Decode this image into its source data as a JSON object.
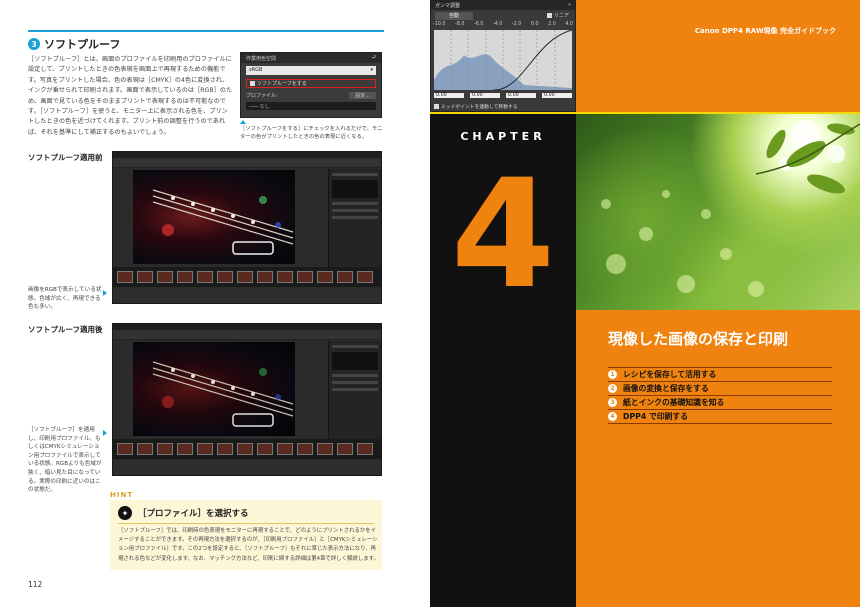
{
  "left_page": {
    "section": {
      "number": "3",
      "title": "ソフトプルーフ"
    },
    "body": "［ソフトプルーフ］とは、画面のプロファイルを印刷用のプロファイルに設定して、プリントしたときの色表現を画面上で再現するための機能です。写真をプリントした場合、色の表現は［CMYK］の4色に変換され、インクが乗せられて印刷されます。画面で表示しているのは［RGB］のため、画面で見ている色をそのままプリントで表現するのは不可能なのです。［ソフトプルーフ］を使うと、モニター上に表示される色を、プリントしたときの色を近づけてくれます。プリント前の調整を行うのであれば、それを基準にして補正するのもよいでしょう。",
    "dialog": {
      "title": "作業用色空間",
      "select_value": "sRGB",
      "checkbox_label": "ソフトプルーフをする",
      "profile_label": "プロファイル:",
      "settings_button": "設定...",
      "profile_value": "なし"
    },
    "dialog_caption": "［ソフトプルーフをする］にチェックを入れるだけで、モニターの色がプリントしたときの色の表現に近くなる。",
    "before_heading": "ソフトプルーフ適用前",
    "before_caption": "画像をRGBで表示している状態。色域が広く、再現できる色も多い。",
    "after_heading": "ソフトプルーフ適用後",
    "after_caption": "［ソフトプルーフ］を適用し、印刷用プロファイル、もしくはCMYKシミュレーション用プロファイルで表示している状態。RGBよりも色域が狭く、暗い見た目になっている。実際の印刷に近いのはこの状態だ。",
    "hint": {
      "tag": "HINT",
      "title": "［プロファイル］を選択する",
      "body": "［ソフトプルーフ］では、印刷時の色表現をモニターに再現することで、どのようにプリントされるかをイメージすることができます。その再現方法を選択するのが、［印刷用プロファイル］と［CMYKシミュレーション用プロファイル］です。この2つを設定すると、［ソフトプルーフ］もそれに準じた表示方法になり、再現される色などが変化します。なお、マッチング方法など、印刷に関する詳細は第4章で詳しく解説します。"
    },
    "page_number": "112"
  },
  "right_page": {
    "curve_panel": {
      "title": "ガンマ調整",
      "mode": "自動",
      "linear_label": "リニア",
      "ticks": [
        "-10.0",
        "-8.0",
        "-6.0",
        "-4.0",
        "-2.0",
        "0.0",
        "2.0",
        "4.0"
      ],
      "values": [
        "0.00",
        "0.00",
        "0.00",
        "0.00"
      ],
      "footer": "ミッドポイントを連動して移動する"
    },
    "guidebook": "Canon DPP4 RAW現像 完全ガイドブック",
    "chapter_label": "CHAPTER",
    "chapter_number": "4",
    "chapter_title": "現像した画像の保存と印刷",
    "toc": [
      {
        "n": "1",
        "label": "レシピを保存して活用する"
      },
      {
        "n": "2",
        "label": "画像の変換と保存をする"
      },
      {
        "n": "3",
        "label": "紙とインクの基礎知識を知る"
      },
      {
        "n": "4",
        "label": "DPP4 で印刷する"
      }
    ]
  },
  "colors": {
    "accent_blue": "#19a0d8",
    "orange": "#f0820f",
    "yellow": "#f5d800"
  }
}
